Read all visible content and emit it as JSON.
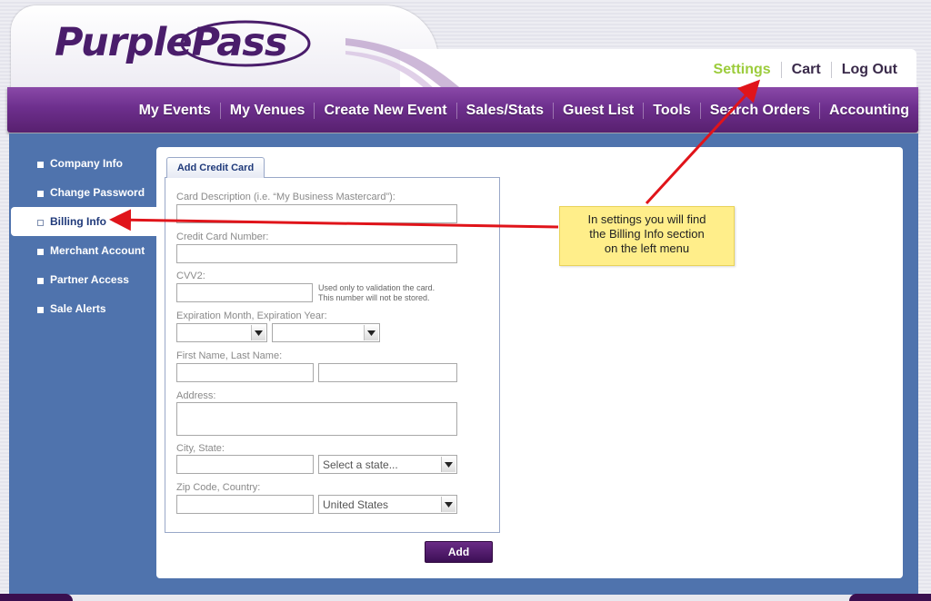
{
  "header": {
    "logo_text": "PurplePass",
    "top_links": [
      {
        "label": "Settings",
        "active": true
      },
      {
        "label": "Cart",
        "active": false
      },
      {
        "label": "Log Out",
        "active": false
      }
    ]
  },
  "nav": {
    "items": [
      "My Events",
      "My Venues",
      "Create New Event",
      "Sales/Stats",
      "Guest List",
      "Tools",
      "Search Orders",
      "Accounting"
    ]
  },
  "sidebar": {
    "items": [
      {
        "label": "Company Info",
        "active": false
      },
      {
        "label": "Change Password",
        "active": false
      },
      {
        "label": "Billing Info",
        "active": true
      },
      {
        "label": "Merchant Account",
        "active": false
      },
      {
        "label": "Partner Access",
        "active": false
      },
      {
        "label": "Sale Alerts",
        "active": false
      }
    ]
  },
  "form": {
    "tab_label": "Add Credit Card",
    "card_description_label": "Card Description (i.e. “My Business Mastercard”):",
    "card_number_label": "Credit Card Number:",
    "cvv_label": "CVV2:",
    "cvv_hint_line1": "Used only to validation the card.",
    "cvv_hint_line2": "This number will not be stored.",
    "expiration_label": "Expiration Month, Expiration Year:",
    "expiration_month": "",
    "expiration_year": "",
    "name_label": "First Name, Last Name:",
    "address_label": "Address:",
    "city_state_label": "City, State:",
    "state_select": "Select a state...",
    "zip_country_label": "Zip Code, Country:",
    "country_select": "United States",
    "add_button": "Add"
  },
  "callout": {
    "text": "In settings you will find\nthe Billing Info section\non the left menu"
  },
  "colors": {
    "brand_purple": "#6d2f8d",
    "content_blue": "#4f73ad",
    "active_link": "#9ccc3c",
    "callout_bg": "#ffee8a",
    "annotation_arrow": "#e0141a"
  }
}
